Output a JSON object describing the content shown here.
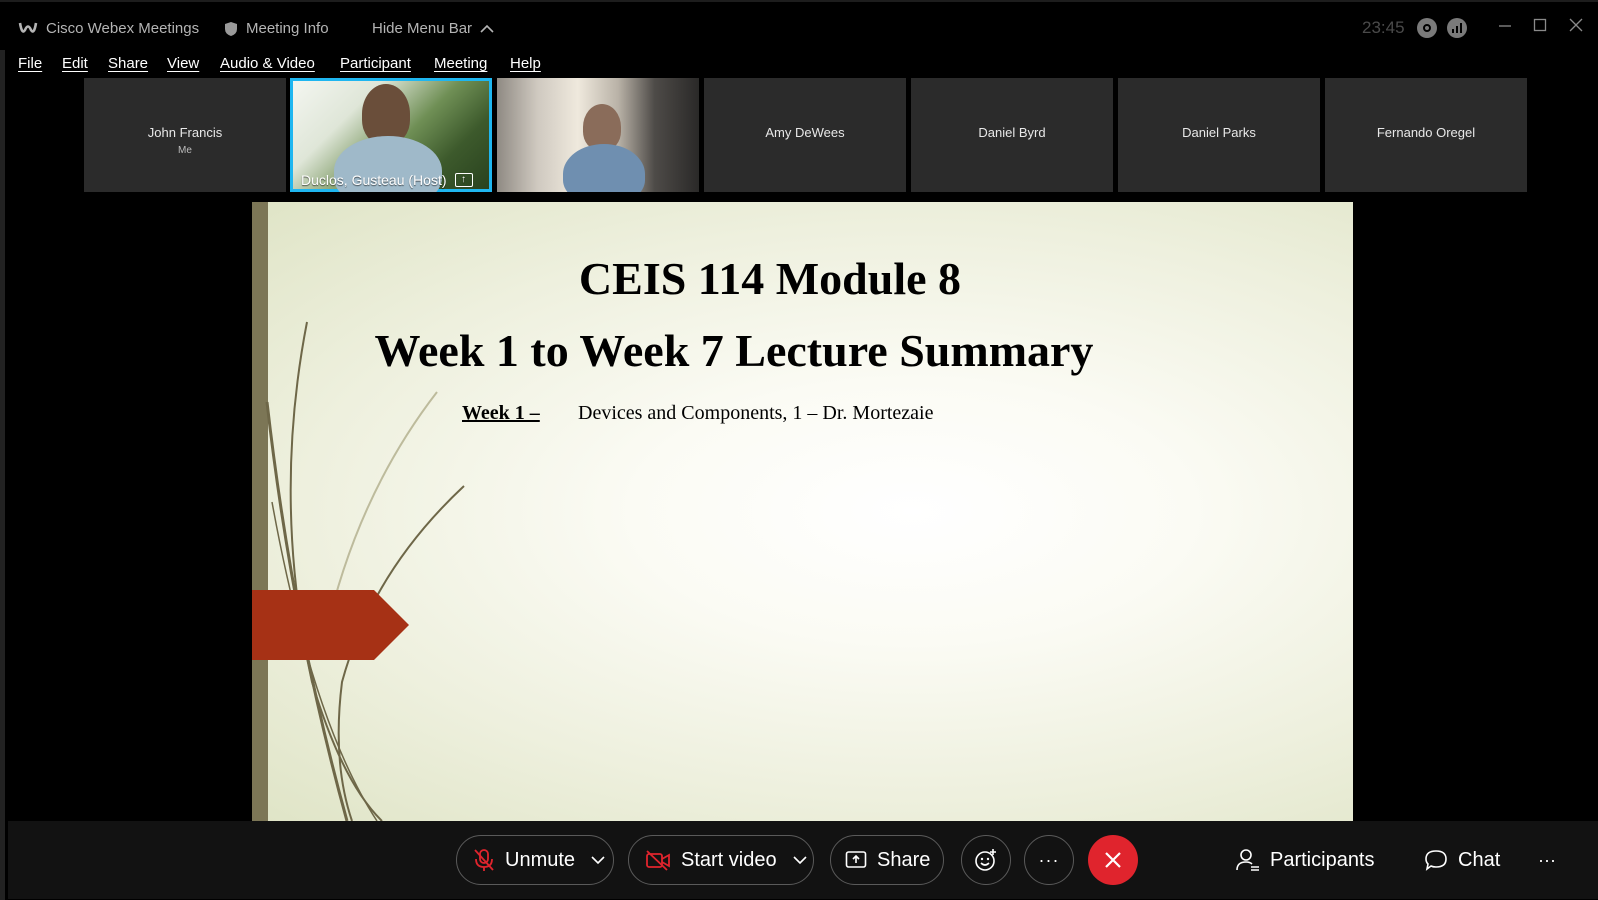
{
  "titlebar": {
    "app_name": "Cisco Webex Meetings",
    "meeting_info": "Meeting Info",
    "hide_menu": "Hide Menu Bar",
    "clock": "23:45"
  },
  "menu": [
    "File",
    "Edit",
    "Share",
    "View",
    "Audio & Video",
    "Participant",
    "Meeting",
    "Help"
  ],
  "participants": {
    "self": {
      "name": "John Francis",
      "sub": "Me"
    },
    "host": {
      "label": "Duclos, Gusteau  (Host)"
    },
    "others": [
      "Amy DeWees",
      "Daniel Byrd",
      "Daniel Parks",
      "Fernando Oregel"
    ]
  },
  "slide": {
    "title": "CEIS 114 Module 8",
    "subtitle": "Week 1 to Week 7 Lecture Summary",
    "week_label": "Week 1 –",
    "week_desc": "Devices and Components, 1 – Dr. Mortezaie",
    "colors": {
      "arrow": "#a63115",
      "bar": "#7c7656",
      "curves": "#6e6748"
    }
  },
  "toolbar": {
    "unmute": "Unmute",
    "start_video": "Start video",
    "share": "Share",
    "more": "···",
    "participants": "Participants",
    "chat": "Chat",
    "overflow": "···"
  },
  "colors": {
    "accent": "#1fb6f0",
    "end": "#e0242d"
  }
}
